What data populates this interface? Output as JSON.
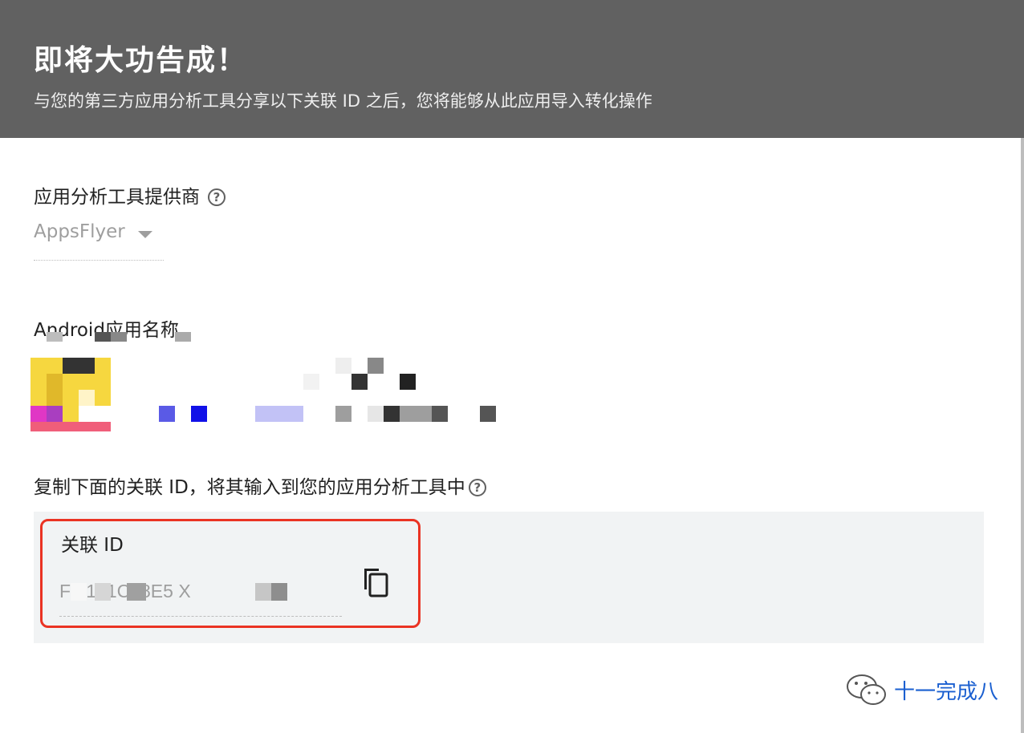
{
  "header": {
    "title": "即将大功告成！",
    "subtitle": "与您的第三方应用分析工具分享以下关联 ID 之后，您将能够从此应用导入转化操作"
  },
  "provider": {
    "label": "应用分析工具提供商",
    "selected": "AppsFlyer",
    "help_icon": "help-circle-icon"
  },
  "app": {
    "label": "Android应用名称"
  },
  "link_id": {
    "instruction": "复制下面的关联 ID，将其输入到您的应用分析工具中",
    "field_label": "关联 ID",
    "value_visible": "F  7151C48E5  X",
    "copy_icon": "copy-icon",
    "help_icon": "help-circle-icon"
  },
  "watermark": {
    "icon": "wechat-icon",
    "text": "十一完成八"
  },
  "colors": {
    "header_bg": "#616161",
    "highlight": "#ea3323",
    "panel_bg": "#f1f3f4"
  }
}
